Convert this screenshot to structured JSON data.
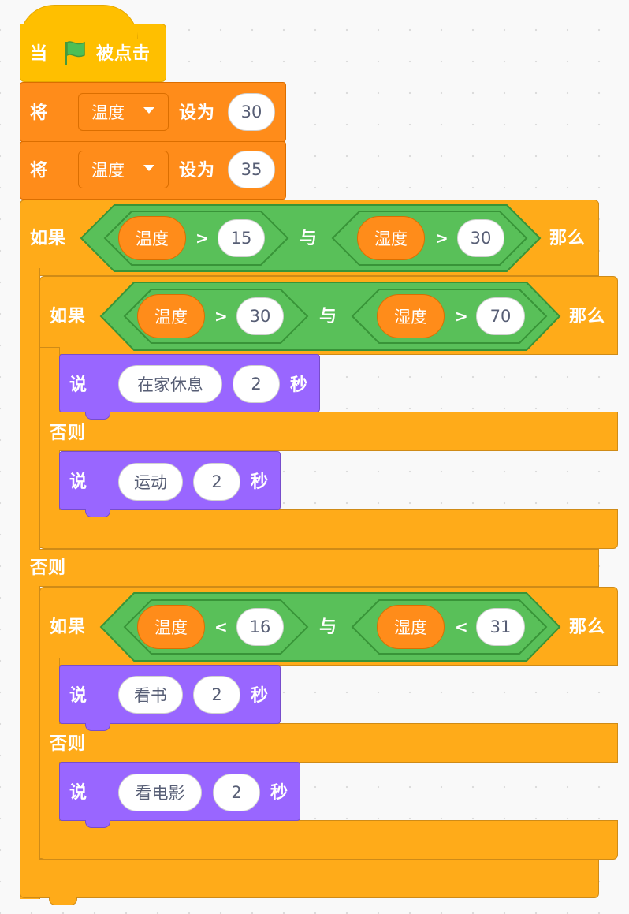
{
  "labels": {
    "when": "当",
    "clicked": "被点击",
    "set": "将",
    "to": "设为",
    "if": "如果",
    "then": "那么",
    "else": "否则",
    "and": "与",
    "say": "说",
    "secs": "秒",
    "gt": ">",
    "lt": "<"
  },
  "vars": {
    "temp": "温度",
    "hum": "湿度"
  },
  "set_values": [
    "30",
    "35"
  ],
  "outer_cond": [
    "15",
    "30"
  ],
  "inner1_cond": [
    "30",
    "70"
  ],
  "inner2_cond": [
    "16",
    "31"
  ],
  "say1": {
    "text": "在家休息",
    "secs": "2"
  },
  "say2": {
    "text": "运动",
    "secs": "2"
  },
  "say3": {
    "text": "看书",
    "secs": "2"
  },
  "say4": {
    "text": "看电影",
    "secs": "2"
  },
  "colors": {
    "events": "#ffbf00",
    "variables": "#ff8c1a",
    "control": "#ffab19",
    "operators": "#59c059",
    "looks": "#9966ff",
    "flag": "#4cbf56"
  }
}
